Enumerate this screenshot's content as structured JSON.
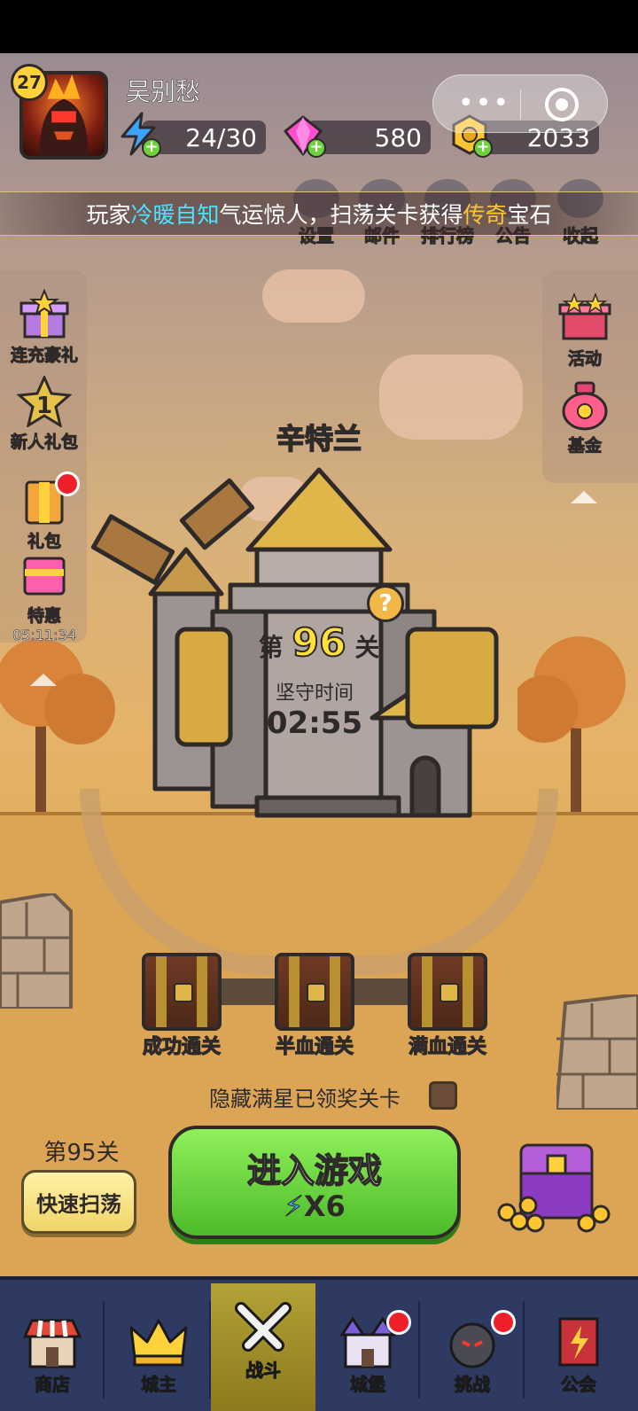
{
  "player": {
    "level": "27",
    "name": "吴别愁"
  },
  "resources": {
    "energy": "24/30",
    "gems": "580",
    "gold": "2033"
  },
  "top_menu": [
    {
      "label": "设置",
      "icon": "gear-icon"
    },
    {
      "label": "邮件",
      "icon": "mail-icon"
    },
    {
      "label": "排行榜",
      "icon": "leaderboard-icon"
    },
    {
      "label": "公告",
      "icon": "notice-icon"
    },
    {
      "label": "收起",
      "icon": "collapse-icon"
    }
  ],
  "announcement": {
    "prefix": "玩家",
    "player": "冷暖自知",
    "middle": "气运惊人，扫荡关卡获得",
    "item": "传奇",
    "suffix": "宝石"
  },
  "left_side": [
    {
      "label": "连充豪礼",
      "icon": "gift-box-icon"
    },
    {
      "label": "新人礼包",
      "icon": "star-one-icon",
      "badge_text": "1"
    },
    {
      "label": "礼包",
      "icon": "gift-pack-icon",
      "has_dot": true
    },
    {
      "label": "特惠",
      "icon": "special-chest-icon",
      "timer": "05:11:34"
    }
  ],
  "right_side": [
    {
      "label": "活动",
      "icon": "event-box-icon"
    },
    {
      "label": "基金",
      "icon": "fund-bag-icon"
    }
  ],
  "level": {
    "location": "辛特兰",
    "stage_prefix": "第",
    "stage_number": "96",
    "stage_suffix": "关",
    "defend_label": "坚守时间",
    "defend_time": "02:55",
    "help": "?"
  },
  "chests": [
    {
      "label": "成功通关"
    },
    {
      "label": "半血通关"
    },
    {
      "label": "满血通关"
    }
  ],
  "hide_option": "隐藏满星已领奖关卡",
  "sweep": {
    "level_label": "第95关",
    "button": "快速扫荡"
  },
  "play": {
    "title": "进入游戏",
    "cost": "X6"
  },
  "bottom_nav": [
    {
      "label": "商店",
      "icon": "shop-icon",
      "active": false
    },
    {
      "label": "城主",
      "icon": "crown-icon",
      "active": false
    },
    {
      "label": "战斗",
      "icon": "swords-icon",
      "active": true
    },
    {
      "label": "城堡",
      "icon": "castle-icon",
      "active": false,
      "has_dot": true
    },
    {
      "label": "挑战",
      "icon": "challenge-icon",
      "active": false,
      "has_dot": true
    },
    {
      "label": "公会",
      "icon": "guild-banner-icon",
      "active": false
    }
  ],
  "colors": {
    "energy": "#3aa4ff",
    "gem": "#ff4fd0",
    "gold": "#ffc531",
    "play_button": "#4cbb2a",
    "nav_bg": "#2e3a62",
    "highlight_player": "#4ae3ff",
    "highlight_item": "#ffc531"
  }
}
